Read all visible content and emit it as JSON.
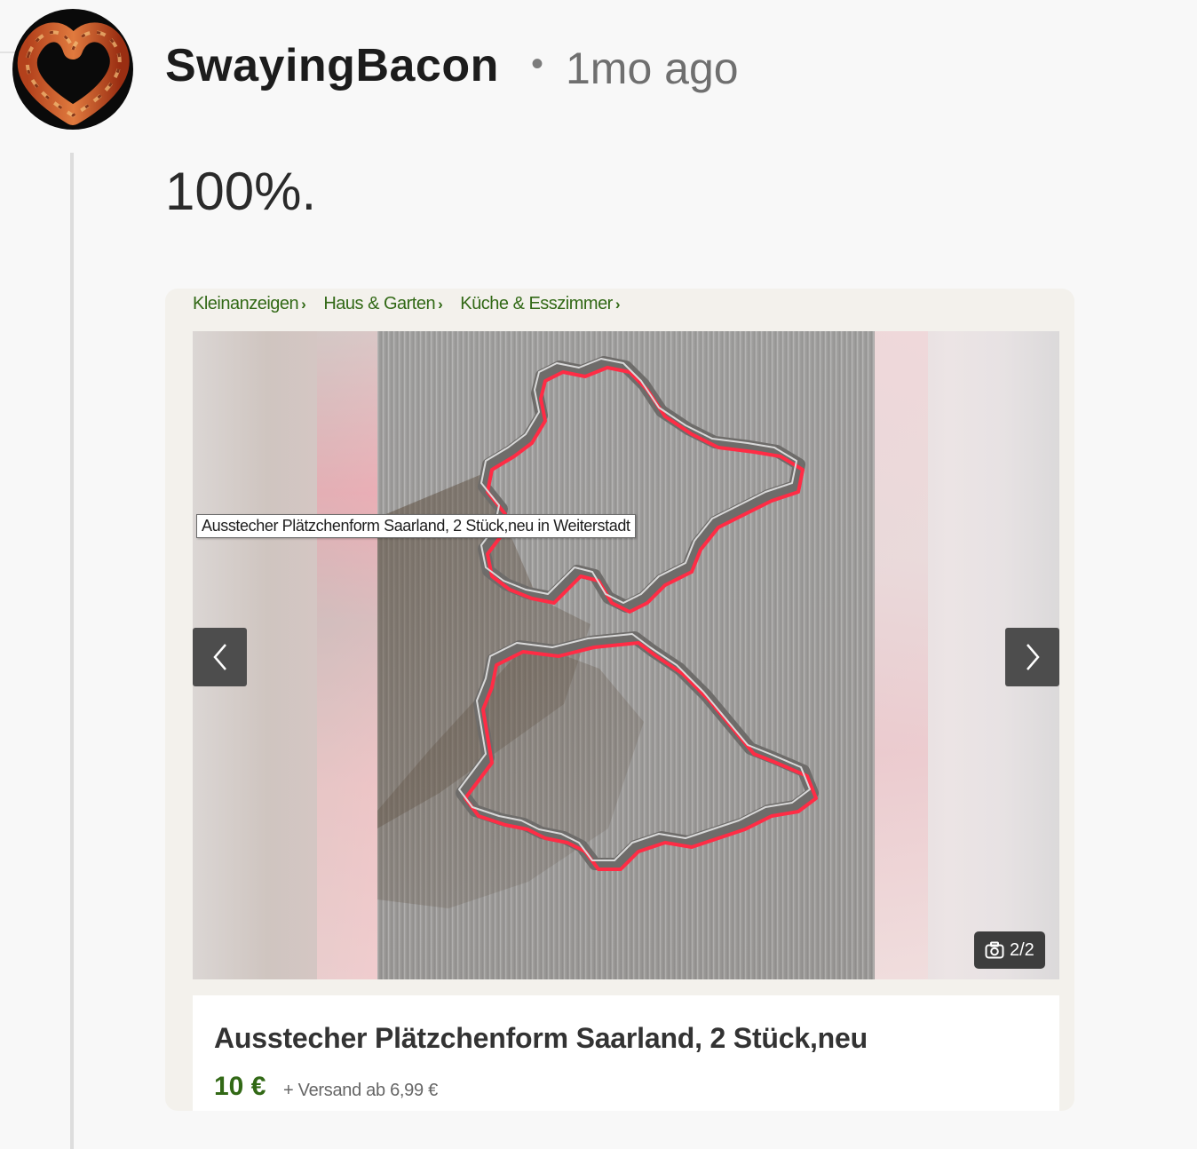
{
  "comment": {
    "username": "SwayingBacon",
    "separator": "•",
    "timestamp": "1mo ago",
    "text": "100%.",
    "avatar_icon": "bacon-heart-avatar"
  },
  "listing": {
    "breadcrumb": [
      "Kleinanzeigen",
      "Haus & Garten",
      "Küche & Esszimmer"
    ],
    "image_tooltip": "Ausstecher Plätzchenform Saarland, 2 Stück,neu in Weiterstadt",
    "image_counter": "2/2",
    "title": "Ausstecher Plätzchenform Saarland, 2 Stück,neu",
    "price": "10 €",
    "shipping": "+ Versand ab 6,99 €",
    "icons": {
      "prev": "chevron-left-icon",
      "next": "chevron-right-icon",
      "camera": "camera-icon",
      "crumb_separator": "chevron-right-small-icon"
    },
    "colors": {
      "brand_green": "#326916",
      "cutter_red": "#ff2c45"
    }
  }
}
